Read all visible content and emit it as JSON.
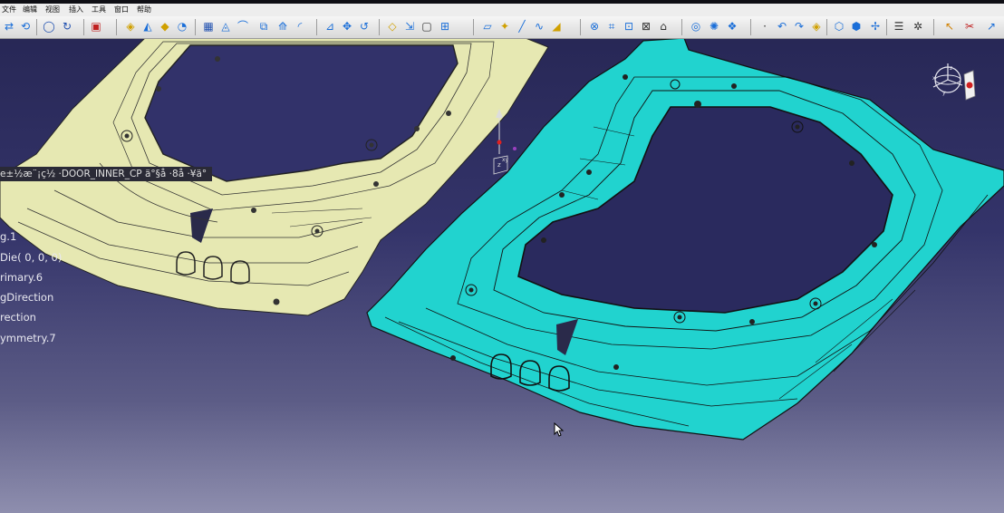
{
  "menu": [
    "文件",
    "编辑",
    "视图",
    "插入",
    "工具",
    "窗口",
    "帮助"
  ],
  "toolbar_icons": [
    "hide-show-icon",
    "swap-visible-icon",
    "circle-tool-icon",
    "rotate-tool-icon",
    "part-icon",
    "surface-icon",
    "sweep-icon",
    "blend-icon",
    "fill-icon",
    "trim-icon",
    "split-icon",
    "extrapolate-icon",
    "join-icon",
    "offset-icon",
    "fillet-icon",
    "draft-icon",
    "translate-icon",
    "rotate-icon",
    "symmetry-icon",
    "scale-icon",
    "affinity-icon",
    "grid-icon",
    "plane-icon",
    "point-icon",
    "line-icon",
    "curve-icon",
    "projection-icon",
    "intersect-icon",
    "boundary-icon",
    "extract-icon",
    "undo-icon",
    "redo-icon",
    "measure-icon",
    "analysis-icon",
    "view-icon",
    "render-icon",
    "catalog-icon",
    "select-icon",
    "help-icon"
  ],
  "tree": {
    "header": "e±½æ¨¡ç½  ·DOOR_INNER_CP ä°§å     ·8å   ·¥ä°",
    "items": [
      "g.1",
      "Die(   0,   0,   0)",
      "rimary.6",
      "gDirection",
      "rection",
      "ymmetry.7"
    ]
  },
  "compass": {
    "axis_labels": [
      "x",
      "y",
      "z"
    ]
  },
  "colors": {
    "background_top": "#252552",
    "background_bottom": "#8e8eae",
    "left_part": "#e6e8b2",
    "right_part": "#21d3cf",
    "edge_lines": "#111111"
  }
}
